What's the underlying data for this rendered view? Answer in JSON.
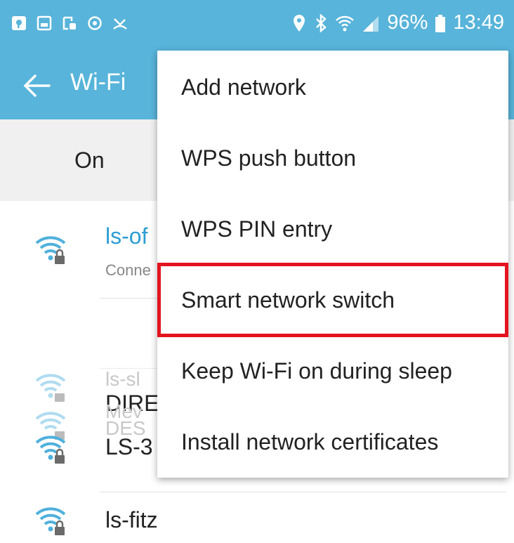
{
  "status_bar": {
    "battery": "96%",
    "time": "13:49",
    "left_icons": [
      "notification-icon",
      "gallery-icon",
      "screenshot-icon",
      "sync-icon",
      "missed-call-icon"
    ],
    "right_icons": [
      "location-icon",
      "bluetooth-icon",
      "wifi-icon",
      "signal-icon",
      "battery-icon"
    ]
  },
  "appbar": {
    "title": "Wi-Fi",
    "back_icon": "back-arrow-icon"
  },
  "toggle": {
    "label": "On"
  },
  "networks": [
    {
      "name": "ls-of",
      "status": "Conne",
      "connected": true
    },
    {
      "name": "ls-sl",
      "ghost": true
    },
    {
      "name": "DIRE"
    },
    {
      "name": "Mev",
      "ghost": true
    },
    {
      "name": "DES",
      "ghost": true
    },
    {
      "name": "LS-3"
    },
    {
      "name": "ls-fitz"
    }
  ],
  "menu": {
    "items": [
      {
        "label": "Add network"
      },
      {
        "label": "WPS push button"
      },
      {
        "label": "WPS PIN entry"
      },
      {
        "label": "Smart network switch",
        "highlighted": true
      },
      {
        "label": "Keep Wi-Fi on during sleep"
      },
      {
        "label": "Install network certificates"
      }
    ]
  },
  "colors": {
    "header": "#58b4da",
    "connected_text": "#2d9dd3",
    "highlight_border": "#e4141f",
    "icon": "#4fb0dc"
  }
}
